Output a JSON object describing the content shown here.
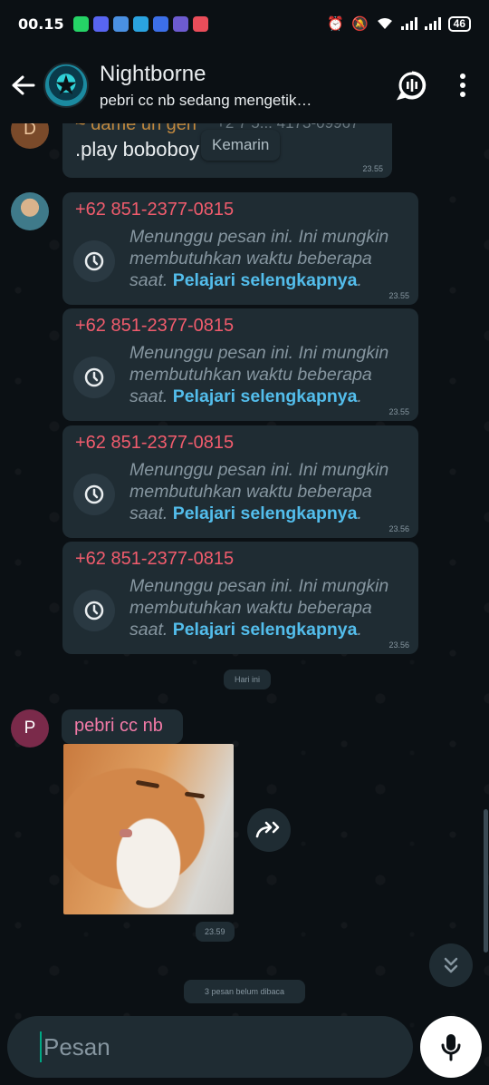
{
  "status_bar": {
    "time": "00.15",
    "battery": "46",
    "app_icons": [
      "whatsapp-icon",
      "discord-icon",
      "chat-icon",
      "telegram-icon",
      "warning-icon",
      "app-icon",
      "app-icon"
    ],
    "app_colors": [
      "#25d366",
      "#5865f2",
      "#4a90e2",
      "#2aa3e0",
      "#3c6fe8",
      "#6d5bd0",
      "#ea4d5a"
    ]
  },
  "header": {
    "title": "Nightborne",
    "subtitle": "pebri cc nb sedang mengetik…"
  },
  "messages": {
    "partial": {
      "sender": "~ dame un gerr",
      "phone_fragment": "+2 7 5... 4173-09967",
      "text": ".play boboboy",
      "time": "23.55",
      "avatar_letter": "D"
    },
    "floating_date": "Kemarin",
    "pending": [
      {
        "sender": "+62 851-2377-0815",
        "text": "Menunggu pesan ini. Ini mungkin membutuhkan waktu beberapa saat.",
        "link": "Pelajari selengkapnya",
        "time": "23.55"
      },
      {
        "sender": "+62 851-2377-0815",
        "text": "Menunggu pesan ini. Ini mungkin membutuhkan waktu beberapa saat.",
        "link": "Pelajari selengkapnya",
        "time": "23.55"
      },
      {
        "sender": "+62 851-2377-0815",
        "text": "Menunggu pesan ini. Ini mungkin membutuhkan waktu beberapa saat.",
        "link": "Pelajari selengkapnya",
        "time": "23.56"
      },
      {
        "sender": "+62 851-2377-0815",
        "text": "Menunggu pesan ini. Ini mungkin membutuhkan waktu beberapa saat.",
        "link": "Pelajari selengkapnya",
        "time": "23.56"
      }
    ],
    "today_chip": "Hari ini",
    "image_msg": {
      "sender": "pebri cc nb",
      "avatar_letter": "P",
      "time": "23.59"
    },
    "unread_chip": "3 pesan belum dibaca"
  },
  "input": {
    "placeholder": "Pesan"
  }
}
